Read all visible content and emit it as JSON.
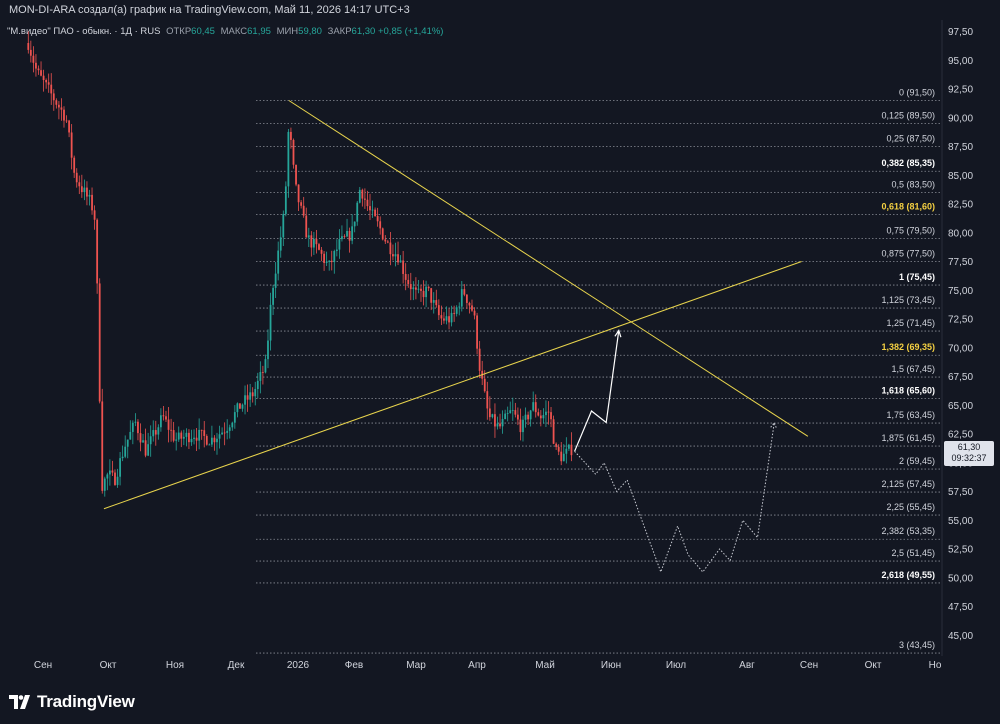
{
  "caption": "MON-DI-ARA создал(а) график на TradingView.com, Май 11, 2026 14:17 UTC+3",
  "legend": {
    "title": "\"М.видео\" ПАО - обыкн. · 1Д · RUS",
    "open_label": "ОТКР",
    "open": "60,45",
    "high_label": "МАКС",
    "high": "61,95",
    "low_label": "МИН",
    "low": "59,80",
    "close_label": "ЗАКР",
    "close": "61,30",
    "change": "+0,85 (+1,41%)"
  },
  "price_label": {
    "price": "61,30",
    "countdown": "09:32:37"
  },
  "brand": "TradingView",
  "colors": {
    "background": "#131722",
    "up": "#26a69a",
    "down": "#ef5350",
    "trendline": "#e8d44d",
    "fib_line": "#b2b5be",
    "text": "#d1d4dc",
    "highlight": "#f5d142"
  },
  "chart_data": {
    "type": "candlestick",
    "ylim": [
      42.5,
      98.5
    ],
    "yticks": [
      "97,50",
      "95,00",
      "92,50",
      "90,00",
      "87,50",
      "85,00",
      "82,50",
      "80,00",
      "77,50",
      "75,00",
      "72,50",
      "70,00",
      "67,50",
      "65,00",
      "62,50",
      "60,00",
      "57,50",
      "55,00",
      "52,50",
      "50,00",
      "47,50",
      "45,00"
    ],
    "x_labels": [
      "Сен",
      "Окт",
      "Ноя",
      "Дек",
      "2026",
      "Фев",
      "Мар",
      "Апр",
      "Май",
      "Июн",
      "Июл",
      "Авг",
      "Сен",
      "Окт",
      "Но"
    ],
    "grid": false,
    "fibonacci": [
      {
        "ratio": "0",
        "price": 91.5,
        "label": "0 (91,50)"
      },
      {
        "ratio": "0.125",
        "price": 89.5,
        "label": "0,125 (89,50)"
      },
      {
        "ratio": "0.25",
        "price": 87.5,
        "label": "0,25 (87,50)"
      },
      {
        "ratio": "0.382",
        "price": 85.35,
        "label": "0,382 (85,35)",
        "bold": true
      },
      {
        "ratio": "0.5",
        "price": 83.5,
        "label": "0,5 (83,50)"
      },
      {
        "ratio": "0.618",
        "price": 81.6,
        "label": "0,618 (81,60)",
        "bold": true,
        "yellow": true
      },
      {
        "ratio": "0.75",
        "price": 79.5,
        "label": "0,75 (79,50)"
      },
      {
        "ratio": "0.875",
        "price": 77.5,
        "label": "0,875 (77,50)"
      },
      {
        "ratio": "1",
        "price": 75.45,
        "label": "1 (75,45)",
        "bold": true
      },
      {
        "ratio": "1.125",
        "price": 73.45,
        "label": "1,125 (73,45)"
      },
      {
        "ratio": "1.25",
        "price": 71.45,
        "label": "1,25 (71,45)"
      },
      {
        "ratio": "1.382",
        "price": 69.35,
        "label": "1,382 (69,35)",
        "bold": true,
        "yellow": true
      },
      {
        "ratio": "1.5",
        "price": 67.45,
        "label": "1,5 (67,45)"
      },
      {
        "ratio": "1.618",
        "price": 65.6,
        "label": "1,618 (65,60)",
        "bold": true
      },
      {
        "ratio": "1.75",
        "price": 63.45,
        "label": "1,75 (63,45)"
      },
      {
        "ratio": "1.875",
        "price": 61.45,
        "label": "1,875 (61,45)"
      },
      {
        "ratio": "2",
        "price": 59.45,
        "label": "2 (59,45)"
      },
      {
        "ratio": "2.125",
        "price": 57.45,
        "label": "2,125 (57,45)"
      },
      {
        "ratio": "2.25",
        "price": 55.45,
        "label": "2,25 (55,45)"
      },
      {
        "ratio": "2.382",
        "price": 53.35,
        "label": "2,382 (53,35)"
      },
      {
        "ratio": "2.5",
        "price": 51.45,
        "label": "2,5 (51,45)"
      },
      {
        "ratio": "2.618",
        "price": 49.55,
        "label": "2,618 (49,55)",
        "bold": true
      },
      {
        "ratio": "3",
        "price": 43.45,
        "label": "3 (43,45)"
      }
    ],
    "price_path": [
      [
        "2025-08-25",
        96.5
      ],
      [
        "2025-08-29",
        94.0
      ],
      [
        "2025-09-05",
        92.0
      ],
      [
        "2025-09-12",
        90.0
      ],
      [
        "2025-09-16",
        85.0
      ],
      [
        "2025-09-19",
        84.0
      ],
      [
        "2025-09-24",
        82.5
      ],
      [
        "2025-09-26",
        81.0
      ],
      [
        "2025-09-29",
        58.0
      ],
      [
        "2025-10-02",
        59.0
      ],
      [
        "2025-10-05",
        58.5
      ],
      [
        "2025-10-10",
        61.5
      ],
      [
        "2025-10-15",
        63.5
      ],
      [
        "2025-10-20",
        61.0
      ],
      [
        "2025-10-28",
        64.0
      ],
      [
        "2025-11-03",
        62.0
      ],
      [
        "2025-11-12",
        62.5
      ],
      [
        "2025-11-20",
        62.0
      ],
      [
        "2025-11-27",
        63.0
      ],
      [
        "2025-12-04",
        65.0
      ],
      [
        "2025-12-10",
        66.0
      ],
      [
        "2025-12-16",
        68.5
      ],
      [
        "2025-12-19",
        75.0
      ],
      [
        "2025-12-23",
        79.5
      ],
      [
        "2025-12-25",
        82.0
      ],
      [
        "2025-12-27",
        89.5
      ],
      [
        "2025-12-30",
        84.0
      ],
      [
        "2026-01-05",
        79.5
      ],
      [
        "2026-01-10",
        78.5
      ],
      [
        "2026-01-15",
        77.0
      ],
      [
        "2026-01-20",
        79.0
      ],
      [
        "2026-01-26",
        80.0
      ],
      [
        "2026-01-30",
        84.0
      ],
      [
        "2026-02-03",
        82.0
      ],
      [
        "2026-02-08",
        80.5
      ],
      [
        "2026-02-12",
        79.0
      ],
      [
        "2026-02-17",
        78.0
      ],
      [
        "2026-02-21",
        76.0
      ],
      [
        "2026-02-26",
        74.5
      ],
      [
        "2026-03-03",
        75.0
      ],
      [
        "2026-03-09",
        72.5
      ],
      [
        "2026-03-15",
        72.5
      ],
      [
        "2026-03-20",
        75.0
      ],
      [
        "2026-03-25",
        73.0
      ],
      [
        "2026-03-28",
        68.0
      ],
      [
        "2026-04-01",
        64.0
      ],
      [
        "2026-04-06",
        63.0
      ],
      [
        "2026-04-12",
        64.5
      ],
      [
        "2026-04-17",
        63.0
      ],
      [
        "2026-04-22",
        65.0
      ],
      [
        "2026-04-26",
        64.0
      ],
      [
        "2026-04-30",
        64.5
      ],
      [
        "2026-05-03",
        61.0
      ],
      [
        "2026-05-06",
        60.5
      ],
      [
        "2026-05-11",
        61.3
      ]
    ],
    "trendlines": [
      {
        "from": [
          "2025-12-27",
          91.5
        ],
        "to": [
          "2026-08-31",
          62.3
        ]
      },
      {
        "from": [
          "2025-09-30",
          56.0
        ],
        "to": [
          "2026-08-28",
          77.5
        ]
      }
    ],
    "forecast_up": [
      [
        "2026-05-12",
        61.0
      ],
      [
        "2026-05-20",
        64.5
      ],
      [
        "2026-05-27",
        63.5
      ],
      [
        "2026-06-02",
        71.5
      ]
    ],
    "forecast_down": [
      [
        "2026-05-12",
        61.0
      ],
      [
        "2026-05-22",
        59.0
      ],
      [
        "2026-05-26",
        60.0
      ],
      [
        "2026-06-01",
        57.5
      ],
      [
        "2026-06-06",
        58.5
      ],
      [
        "2026-06-22",
        50.5
      ],
      [
        "2026-06-30",
        54.5
      ],
      [
        "2026-07-05",
        52.0
      ],
      [
        "2026-07-12",
        50.5
      ],
      [
        "2026-07-20",
        52.5
      ],
      [
        "2026-07-25",
        51.5
      ],
      [
        "2026-07-31",
        55.0
      ],
      [
        "2026-08-07",
        53.5
      ],
      [
        "2026-08-15",
        63.5
      ]
    ]
  }
}
